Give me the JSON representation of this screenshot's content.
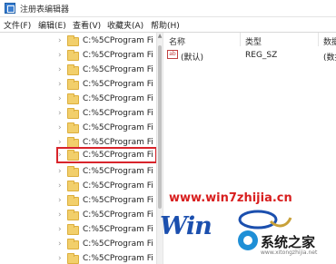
{
  "window": {
    "title": "注册表编辑器"
  },
  "menubar": {
    "items": [
      {
        "label": "文件(F)"
      },
      {
        "label": "编辑(E)"
      },
      {
        "label": "查看(V)"
      },
      {
        "label": "收藏夹(A)"
      },
      {
        "label": "帮助(H)"
      }
    ]
  },
  "tree": {
    "items": [
      {
        "label": "C:%5CProgram Fi",
        "selected": false
      },
      {
        "label": "C:%5CProgram Fi",
        "selected": false
      },
      {
        "label": "C:%5CProgram Fi",
        "selected": false
      },
      {
        "label": "C:%5CProgram Fi",
        "selected": false
      },
      {
        "label": "C:%5CProgram Fi",
        "selected": false
      },
      {
        "label": "C:%5CProgram Fi",
        "selected": false
      },
      {
        "label": "C:%5CProgram Fi",
        "selected": false
      },
      {
        "label": "C:%5CProgram Fi",
        "selected": false
      },
      {
        "label": "C:%5CProgram Fi",
        "selected": true
      },
      {
        "label": "C:%5CProgram Fi",
        "selected": false
      },
      {
        "label": "C:%5CProgram Fi",
        "selected": false
      },
      {
        "label": "C:%5CProgram Fi",
        "selected": false
      },
      {
        "label": "C:%5CProgram Fi",
        "selected": false
      },
      {
        "label": "C:%5CProgram Fi",
        "selected": false
      },
      {
        "label": "C:%5CProgram Fi",
        "selected": false
      },
      {
        "label": "C:%5CProgram Fi",
        "selected": false
      }
    ]
  },
  "list": {
    "columns": {
      "name": "名称",
      "type": "类型",
      "data": "数据"
    },
    "rows": [
      {
        "icon": "ab",
        "name": "(默认)",
        "type": "REG_SZ",
        "data": "(数据"
      }
    ]
  },
  "watermark": {
    "url": "www.win7zhijia.cn",
    "logo_text": "Win",
    "site_name": "系统之家",
    "site_domain": "www.xitongzhijia.net"
  },
  "colors": {
    "highlight_border": "#d8242b",
    "folder": "#f2cf6b",
    "watermark_red": "#d81e1e",
    "watermark_blue": "#1b4fae"
  },
  "icons": {
    "app": "regedit-icon",
    "folder": "folder-icon",
    "string_value": "string-value-icon",
    "expand": "chevron-right-icon"
  }
}
